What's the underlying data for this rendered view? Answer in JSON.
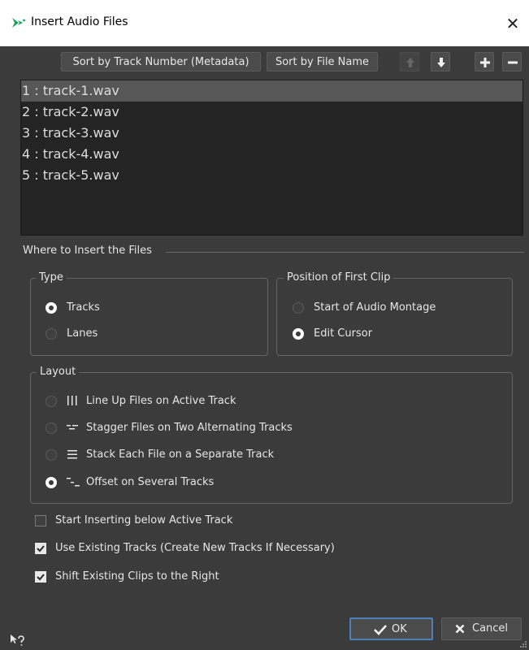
{
  "window": {
    "title": "Insert Audio Files",
    "close_glyph": "✕"
  },
  "toolbar": {
    "sort_metadata_label": "Sort by Track Number (Metadata)",
    "sort_filename_label": "Sort by File Name"
  },
  "files": [
    "1 : track-1.wav",
    "2 : track-2.wav",
    "3 : track-3.wav",
    "4 : track-4.wav",
    "5 : track-5.wav"
  ],
  "insert_section": {
    "title": "Where to Insert the Files"
  },
  "type_group": {
    "title": "Type",
    "options": [
      {
        "label": "Tracks",
        "checked": true
      },
      {
        "label": "Lanes",
        "checked": false
      }
    ]
  },
  "position_group": {
    "title": "Position of First Clip",
    "options": [
      {
        "label": "Start of Audio Montage",
        "checked": false
      },
      {
        "label": "Edit Cursor",
        "checked": true
      }
    ]
  },
  "layout_group": {
    "title": "Layout",
    "options": [
      {
        "label": "Line Up Files on Active Track",
        "icon": "line-up-icon",
        "checked": false
      },
      {
        "label": "Stagger Files on Two Alternating Tracks",
        "icon": "stagger-icon",
        "checked": false
      },
      {
        "label": "Stack Each File on a Separate Track",
        "icon": "stack-icon",
        "checked": false
      },
      {
        "label": "Offset on Several Tracks",
        "icon": "offset-icon",
        "checked": true
      }
    ]
  },
  "checkboxes": [
    {
      "label": "Start Inserting below Active Track",
      "checked": false
    },
    {
      "label": "Use Existing Tracks (Create New Tracks If Necessary)",
      "checked": true
    },
    {
      "label": "Shift Existing Clips to the Right",
      "checked": true
    }
  ],
  "buttons": {
    "ok_label": "OK",
    "cancel_label": "Cancel"
  },
  "colors": {
    "background": "#3b3b3b",
    "list_bg": "#242424",
    "selected_row": "#575757",
    "accent": "#4f7fb8",
    "app_icon": "#18a05a"
  }
}
